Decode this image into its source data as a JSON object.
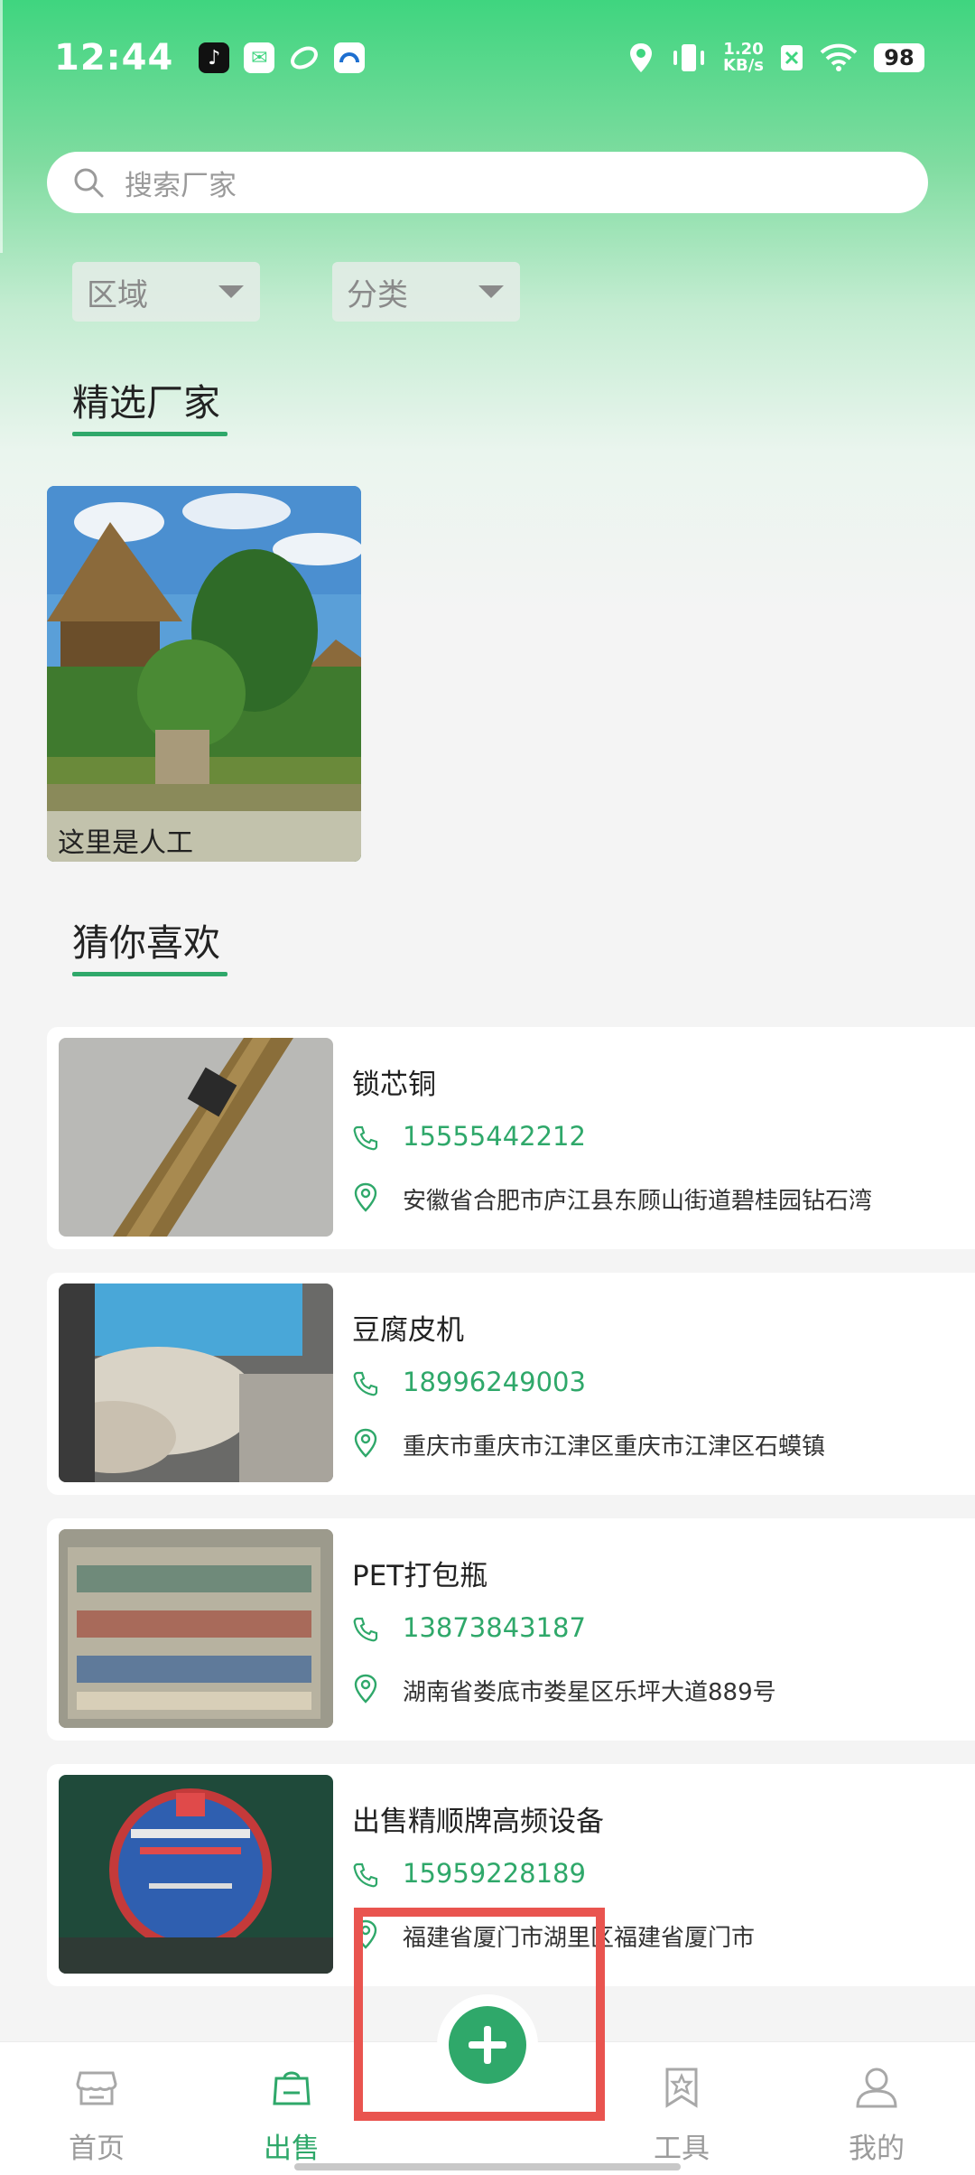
{
  "status_bar": {
    "time": "12:44",
    "net_speed_value": "1.20",
    "net_speed_unit": "KB/s",
    "battery": "98",
    "icons": [
      "tiktok-icon",
      "mail-app-icon",
      "app-icon",
      "app-icon",
      "location-icon",
      "vibrate-icon",
      "no-sim-icon",
      "wifi-icon"
    ]
  },
  "search": {
    "placeholder": "搜索厂家"
  },
  "filters": [
    {
      "label": "区域"
    },
    {
      "label": "分类"
    }
  ],
  "sections": {
    "featured_title": "精选厂家",
    "guess_title": "猜你喜欢"
  },
  "featured": [
    {
      "caption": "这里是人工"
    }
  ],
  "list": [
    {
      "title": "锁芯铜",
      "phone": "15555442212",
      "address": "安徽省合肥市庐江县东顾山街道碧桂园钻石湾"
    },
    {
      "title": "豆腐皮机",
      "phone": "18996249003",
      "address": "重庆市重庆市江津区重庆市江津区石蟆镇"
    },
    {
      "title": "PET打包瓶",
      "phone": "13873843187",
      "address": "湖南省娄底市娄星区乐坪大道889号"
    },
    {
      "title": "出售精顺牌高频设备",
      "phone": "15959228189",
      "address": "福建省厦门市湖里区福建省厦门市"
    }
  ],
  "bottom_nav": [
    {
      "label": "首页",
      "active": false
    },
    {
      "label": "出售",
      "active": true
    },
    {
      "label": "",
      "active": false
    },
    {
      "label": "工具",
      "active": false
    },
    {
      "label": "我的",
      "active": false
    }
  ],
  "colors": {
    "accent": "#2fa86a",
    "highlight": "#e9544f"
  }
}
